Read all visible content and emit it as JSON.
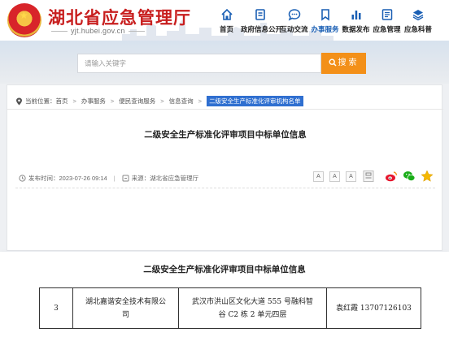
{
  "header": {
    "title": "湖北省应急管理厅",
    "url": "yjt.hubei.gov.cn",
    "nav": [
      {
        "label": "首页",
        "icon": "home-icon",
        "active": false
      },
      {
        "label": "政府信息公开",
        "icon": "document-icon",
        "active": false
      },
      {
        "label": "互动交流",
        "icon": "chat-icon",
        "active": false
      },
      {
        "label": "办事服务",
        "icon": "bookmark-icon",
        "active": true
      },
      {
        "label": "数据发布",
        "icon": "bar-chart-icon",
        "active": false
      },
      {
        "label": "应急管理",
        "icon": "list-icon",
        "active": false
      },
      {
        "label": "应急科普",
        "icon": "layers-icon",
        "active": false
      }
    ]
  },
  "search": {
    "placeholder": "请输入关键字",
    "button_label": "搜索"
  },
  "breadcrumb": {
    "prefix": "当前位置：",
    "items": [
      "首页",
      "办事服务",
      "便民查询服务",
      "信息查询"
    ],
    "current": "二级安全生产标准化评审机构名单"
  },
  "article": {
    "title": "二级安全生产标准化评审项目中标单位信息",
    "publish_time": "发布时间：2023-07-26 09:14",
    "source": "来源：湖北省应急管理厅",
    "font_sizes": [
      "A",
      "A",
      "A"
    ]
  },
  "sticky_title": "二级安全生产标准化评审项目中标单位信息",
  "table": {
    "rows": [
      {
        "no": "3",
        "company": [
          "湖北嘉谐安全技术有限公",
          "司"
        ],
        "address": [
          "武汉市洪山区文化大道 555 号融科智",
          "谷 C2 栋 2 单元四层"
        ],
        "contact": "袁红霞 13707126103"
      }
    ]
  },
  "colors": {
    "title_red": "#c81e1e",
    "accent_blue": "#1a5fb4",
    "search_orange": "#f39019",
    "crumb_blue": "#2f6fd0"
  }
}
